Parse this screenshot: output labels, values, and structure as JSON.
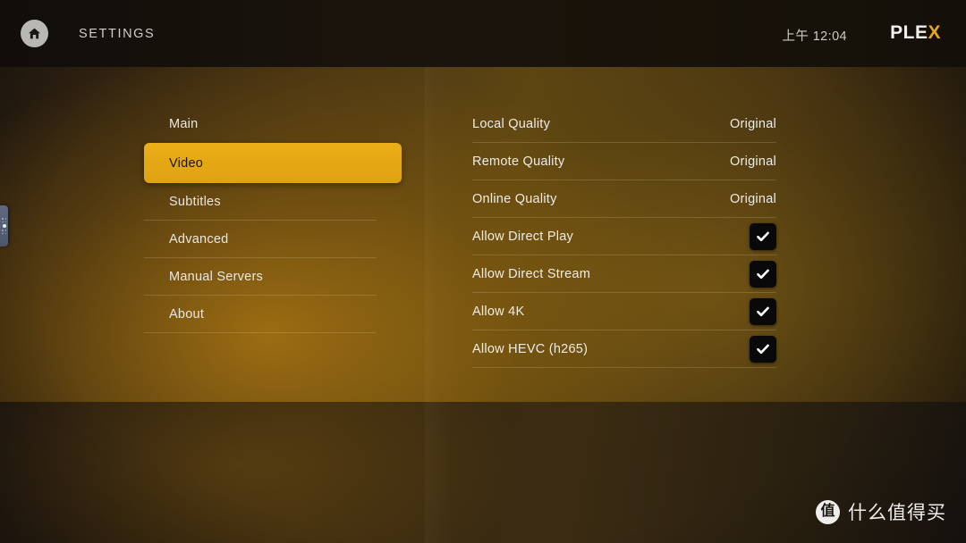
{
  "header": {
    "home_icon": "home-icon",
    "title": "SETTINGS",
    "clock": "上午 12:04",
    "logo_main": "PLE",
    "logo_accent": "X"
  },
  "side_handle": {
    "icon": "drag-handle-icon"
  },
  "nav": {
    "items": [
      {
        "label": "Main",
        "selected": false
      },
      {
        "label": "Video",
        "selected": true
      },
      {
        "label": "Subtitles",
        "selected": false
      },
      {
        "label": "Advanced",
        "selected": false
      },
      {
        "label": "Manual Servers",
        "selected": false
      },
      {
        "label": "About",
        "selected": false
      }
    ]
  },
  "settings": {
    "rows": [
      {
        "label": "Local Quality",
        "type": "value",
        "value": "Original"
      },
      {
        "label": "Remote Quality",
        "type": "value",
        "value": "Original"
      },
      {
        "label": "Online Quality",
        "type": "value",
        "value": "Original"
      },
      {
        "label": "Allow Direct Play",
        "type": "checkbox",
        "checked": true
      },
      {
        "label": "Allow Direct Stream",
        "type": "checkbox",
        "checked": true
      },
      {
        "label": "Allow 4K",
        "type": "checkbox",
        "checked": true
      },
      {
        "label": "Allow HEVC (h265)",
        "type": "checkbox",
        "checked": true
      }
    ]
  },
  "watermark": {
    "logo_char": "值",
    "text": "什么值得买"
  },
  "colors": {
    "accent": "#e6a817",
    "header_bg": "#15100c",
    "selected_text": "#1d1508",
    "text": "#eeece8",
    "checkbox_bg": "#09090a"
  }
}
